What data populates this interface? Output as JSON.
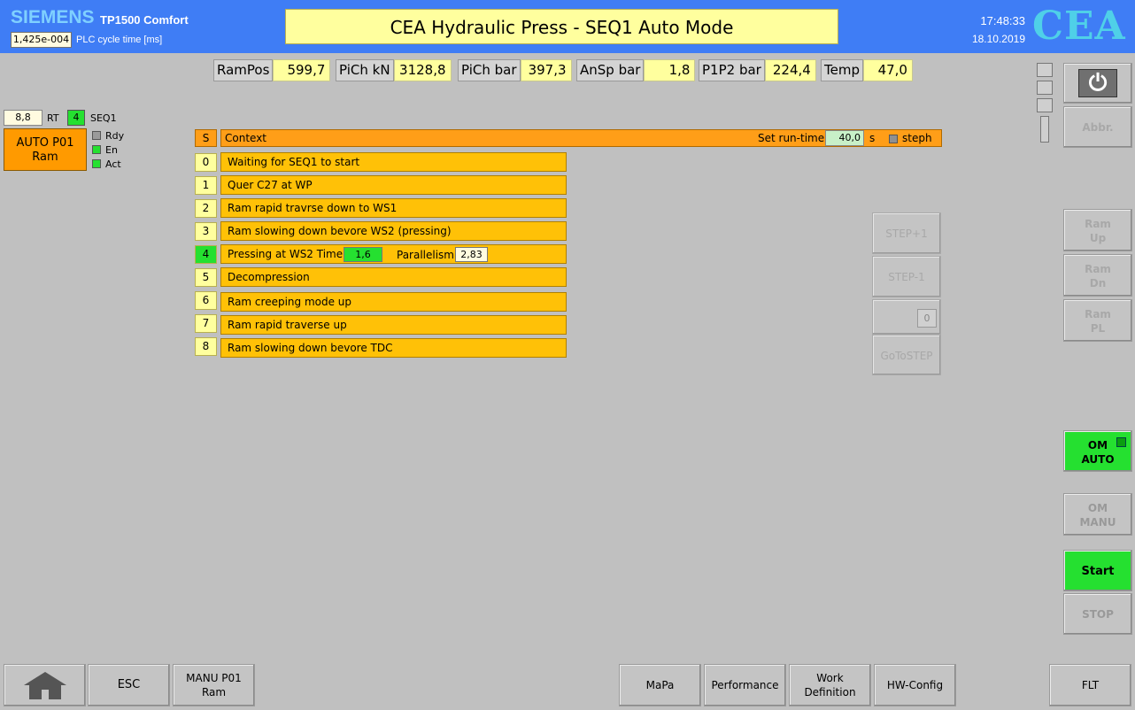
{
  "header": {
    "brand": "SIEMENS",
    "model": "TP1500 Comfort",
    "cycle_value": "1,425e-004",
    "cycle_label": "PLC cycle time [ms]",
    "title": "CEA Hydraulic Press - SEQ1 Auto Mode",
    "time": "17:48:33",
    "date": "18.10.2019",
    "logo": "CEA"
  },
  "measurements": [
    {
      "label": "RamPos",
      "value": "599,7"
    },
    {
      "label": "PiCh kN",
      "value": "3128,8"
    },
    {
      "label": "PiCh bar",
      "value": "397,3"
    },
    {
      "label": "AnSp bar",
      "value": "1,8"
    },
    {
      "label": "P1P2 bar",
      "value": "224,4"
    },
    {
      "label": "Temp",
      "value": "47,0"
    }
  ],
  "module": {
    "rt_value": "8,8",
    "rt_label": "RT",
    "seq_step": "4",
    "seq_label": "SEQ1",
    "button_line1": "AUTO P01",
    "button_line2": "Ram",
    "status": [
      {
        "label": "Rdy",
        "color": "#9a9a9a"
      },
      {
        "label": "En",
        "color": "#25e030"
      },
      {
        "label": "Act",
        "color": "#25e030"
      }
    ]
  },
  "sequence": {
    "col_step": "S",
    "col_context": "Context",
    "runtime_label": "Set run-time",
    "runtime_value": "40,0",
    "runtime_unit": "s",
    "steph_label": "steph",
    "steps": [
      {
        "num": "0",
        "text": "Waiting for SEQ1 to start"
      },
      {
        "num": "1",
        "text": "Quer C27 at WP"
      },
      {
        "num": "2",
        "text": "Ram rapid travrse down to WS1"
      },
      {
        "num": "3",
        "text": "Ram slowing down bevore WS2 (pressing)"
      },
      {
        "num": "4",
        "text": "Pressing at WS2 Time"
      },
      {
        "num": "5",
        "text": "Decompression"
      },
      {
        "num": "6",
        "text": "Ram creeping mode up"
      },
      {
        "num": "7",
        "text": "Ram rapid traverse up"
      },
      {
        "num": "8",
        "text": "Ram slowing down bevore TDC"
      }
    ],
    "pressing_time": "1,6",
    "parallelism_label": "Parallelism",
    "parallelism_value": "2,83"
  },
  "step_controls": {
    "step_plus": "STEP+1",
    "step_minus": "STEP-1",
    "goto_value": "0",
    "goto": "GoToSTEP"
  },
  "right_panel": {
    "power_glyph": "⏻",
    "abbr": "Abbr.",
    "ram_up_1": "Ram",
    "ram_up_2": "Up",
    "ram_dn_1": "Ram",
    "ram_dn_2": "Dn",
    "ram_pl_1": "Ram",
    "ram_pl_2": "PL",
    "om_auto_1": "OM",
    "om_auto_2": "AUTO",
    "om_manu_1": "OM",
    "om_manu_2": "MANU",
    "start": "Start",
    "stop": "STOP"
  },
  "bottom": {
    "esc": "ESC",
    "manu_1": "MANU P01",
    "manu_2": "Ram",
    "mapa": "MaPa",
    "performance": "Performance",
    "work_1": "Work",
    "work_2": "Definition",
    "hwconfig": "HW-Config",
    "flt": "FLT"
  },
  "colors": {
    "header": "#3f7df5",
    "active_step": "#25e030",
    "step_row": "#ffc107",
    "table_header": "#ff9e18"
  }
}
